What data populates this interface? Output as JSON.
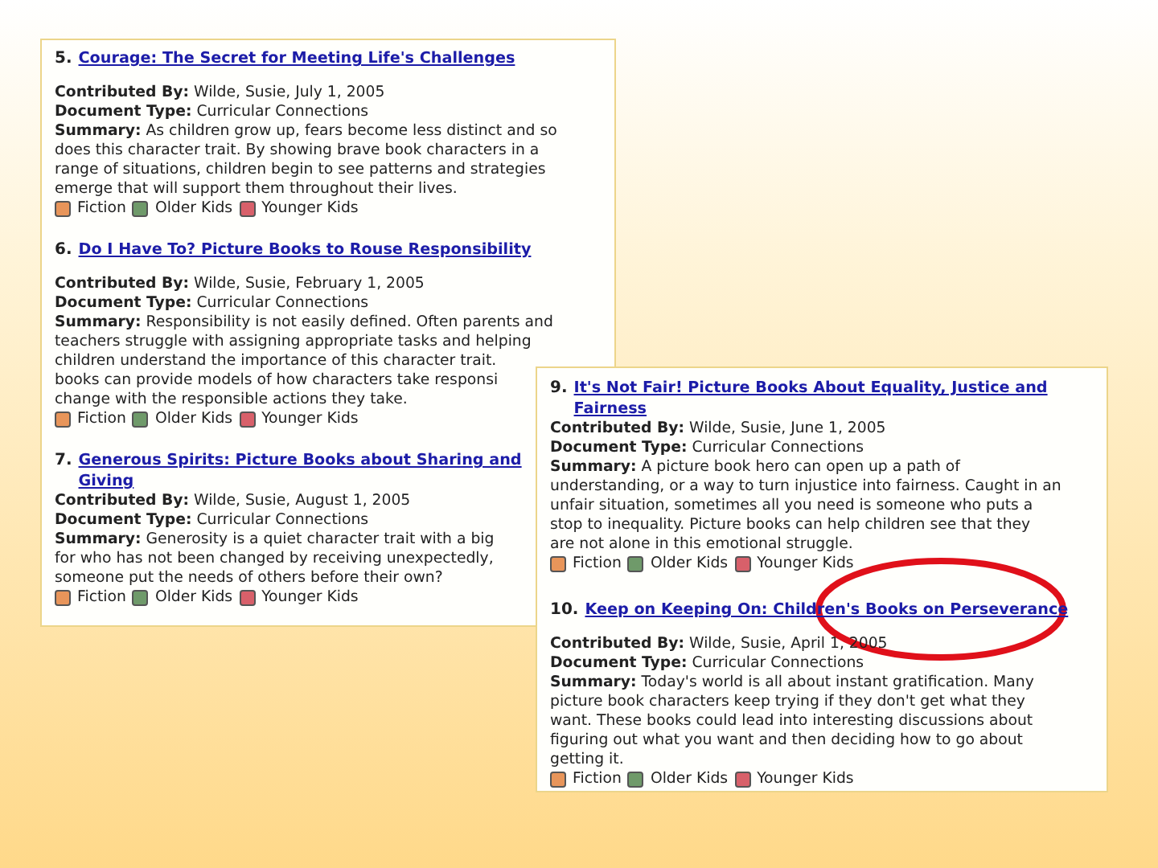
{
  "panels": [
    {
      "items": [
        {
          "number": "5.",
          "title_lines": [
            "Courage: The Secret for Meeting Life's Challenges"
          ],
          "contributed_label": "Contributed By:",
          "contributed": "Wilde, Susie, July 1, 2005",
          "type_label": "Document Type:",
          "doc_type": "Curricular Connections",
          "summary_label": "Summary:",
          "summary_lines": [
            "As children grow up, fears become less distinct and so",
            "does this character trait. By showing brave book characters in a",
            "range of situations, children begin to see patterns and strategies",
            "emerge that will support them throughout their lives."
          ],
          "tags": [
            {
              "label": "Fiction",
              "color": "#e8955a"
            },
            {
              "label": "Older Kids",
              "color": "#6f9a6a"
            },
            {
              "label": "Younger Kids",
              "color": "#d8606a"
            }
          ]
        },
        {
          "number": "6.",
          "title_lines": [
            "Do I Have To? Picture Books to Rouse Responsibility"
          ],
          "contributed_label": "Contributed By:",
          "contributed": "Wilde, Susie, February 1, 2005",
          "type_label": "Document Type:",
          "doc_type": "Curricular Connections",
          "summary_label": "Summary:",
          "summary_lines": [
            "Responsibility is not easily defined. Often parents and",
            "teachers struggle with assigning appropriate tasks and helping",
            "children understand the importance of this character trait.",
            "books can provide models of how characters take responsi",
            "change with the responsible actions they take."
          ],
          "tags": [
            {
              "label": "Fiction",
              "color": "#e8955a"
            },
            {
              "label": "Older Kids",
              "color": "#6f9a6a"
            },
            {
              "label": "Younger Kids",
              "color": "#d8606a"
            }
          ]
        },
        {
          "number": "7.",
          "title_lines": [
            "Generous Spirits: Picture Books about Sharing and",
            "Giving"
          ],
          "contributed_label": "Contributed By:",
          "contributed": "Wilde, Susie, August 1, 2005",
          "type_label": "Document Type:",
          "doc_type": "Curricular Connections",
          "summary_label": "Summary:",
          "summary_lines": [
            "Generosity is a quiet character trait with a big",
            "for who has not been changed by receiving unexpectedly,",
            "someone put the needs of others before their own?"
          ],
          "tags": [
            {
              "label": "Fiction",
              "color": "#e8955a"
            },
            {
              "label": "Older Kids",
              "color": "#6f9a6a"
            },
            {
              "label": "Younger Kids",
              "color": "#d8606a"
            }
          ]
        }
      ]
    },
    {
      "items": [
        {
          "number": "9.",
          "title_lines": [
            "It's Not Fair! Picture Books About Equality, Justice and",
            "Fairness"
          ],
          "contributed_label": "Contributed By:",
          "contributed": "Wilde, Susie, June 1, 2005",
          "type_label": "Document Type:",
          "doc_type": "Curricular Connections",
          "summary_label": "Summary:",
          "summary_lines": [
            "A picture book hero can open up a path of",
            "understanding, or a way to turn injustice into fairness. Caught in an",
            "unfair situation, sometimes all you need is someone who puts a",
            "stop to inequality. Picture books can help children see that they",
            "are not alone in this emotional struggle."
          ],
          "tags": [
            {
              "label": "Fiction",
              "color": "#e8955a"
            },
            {
              "label": "Older Kids",
              "color": "#6f9a6a"
            },
            {
              "label": "Younger Kids",
              "color": "#d8606a"
            }
          ]
        },
        {
          "number": "10.",
          "title_lines": [
            "Keep on Keeping On: Children's Books on Perseverance"
          ],
          "contributed_label": "Contributed By:",
          "contributed": "Wilde, Susie, April 1, 2005",
          "type_label": "Document Type:",
          "doc_type": "Curricular Connections",
          "summary_label": "Summary:",
          "summary_lines": [
            "Today's world is all about instant gratification. Many",
            "picture book characters keep trying if they don't get what they",
            "want. These books could lead into interesting discussions about",
            "figuring out what you want and then deciding how to go about",
            "getting it."
          ],
          "tags": [
            {
              "label": "Fiction",
              "color": "#e8955a"
            },
            {
              "label": "Older Kids",
              "color": "#6f9a6a"
            },
            {
              "label": "Younger Kids",
              "color": "#d8606a"
            }
          ]
        }
      ]
    }
  ]
}
